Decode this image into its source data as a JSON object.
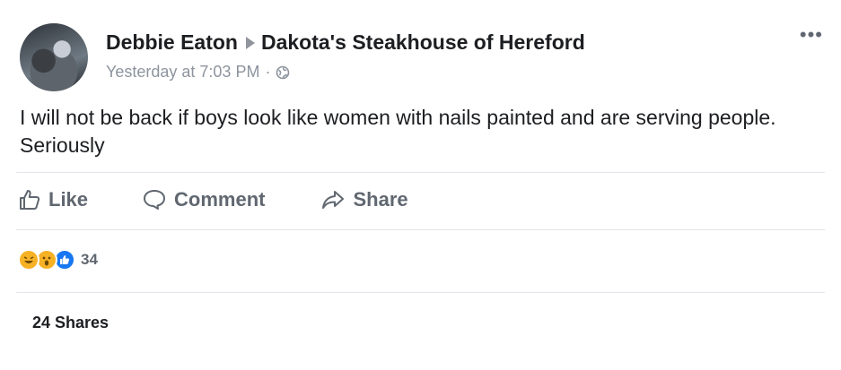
{
  "post": {
    "author": "Debbie Eaton",
    "page": "Dakota's Steakhouse of Hereford",
    "timestamp": "Yesterday at 7:03 PM",
    "separator": "·",
    "privacy_icon": "globe-icon",
    "menu_icon": "more-options-icon",
    "more_label": "•••",
    "text": "I will not be back if boys look like women with nails painted and are serving people. Seriously"
  },
  "actions": {
    "like_label": "Like",
    "comment_label": "Comment",
    "share_label": "Share"
  },
  "reactions": {
    "types": [
      "haha",
      "wow",
      "like"
    ],
    "count": "34"
  },
  "shares": {
    "label": "24 Shares"
  },
  "colors": {
    "text": "#1c1e21",
    "muted": "#606770",
    "meta": "#8d949e",
    "divider": "#e4e6eb",
    "like_blue": "#1877f2",
    "emoji_yellow": "#f7b125"
  }
}
